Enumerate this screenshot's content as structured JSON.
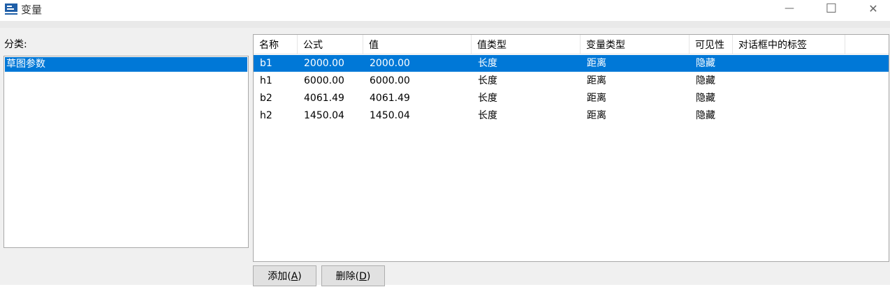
{
  "window": {
    "title": "变量",
    "minimize_glyph": "—",
    "maximize_glyph": "☐",
    "close_glyph": "✕"
  },
  "sidebar": {
    "label": "分类:",
    "items": [
      {
        "label": "草图参数",
        "selected": true
      }
    ]
  },
  "table": {
    "columns": [
      "名称",
      "公式",
      "值",
      "值类型",
      "变量类型",
      "可见性",
      "对话框中的标签"
    ],
    "rows": [
      {
        "name": "b1",
        "formula": "2000.00",
        "value": "2000.00",
        "value_type": "长度",
        "var_type": "距离",
        "visibility": "隐藏",
        "label": "",
        "selected": true
      },
      {
        "name": "h1",
        "formula": "6000.00",
        "value": "6000.00",
        "value_type": "长度",
        "var_type": "距离",
        "visibility": "隐藏",
        "label": "",
        "selected": false
      },
      {
        "name": "b2",
        "formula": "4061.49",
        "value": "4061.49",
        "value_type": "长度",
        "var_type": "距离",
        "visibility": "隐藏",
        "label": "",
        "selected": false
      },
      {
        "name": "h2",
        "formula": "1450.04",
        "value": "1450.04",
        "value_type": "长度",
        "var_type": "距离",
        "visibility": "隐藏",
        "label": "",
        "selected": false
      }
    ]
  },
  "buttons": {
    "add_label": "添加(",
    "add_mnemonic": "A",
    "add_close": ")",
    "delete_label": "删除(",
    "delete_mnemonic": "D",
    "delete_close": ")"
  },
  "colors": {
    "selection": "#0078d7",
    "window_bg": "#f0f0f0"
  }
}
